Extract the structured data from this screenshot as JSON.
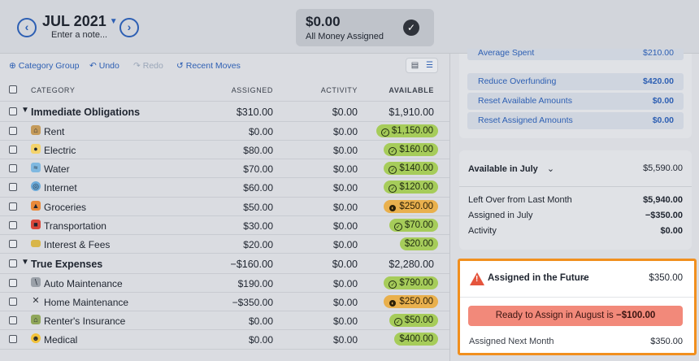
{
  "header": {
    "month": "JUL 2021",
    "note_placeholder": "Enter a note...",
    "assigned_amount": "$0.00",
    "assigned_label": "All Money Assigned"
  },
  "toolbar": {
    "category_group": "Category Group",
    "undo": "Undo",
    "redo": "Redo",
    "recent_moves": "Recent Moves"
  },
  "table": {
    "columns": {
      "category": "CATEGORY",
      "assigned": "ASSIGNED",
      "activity": "ACTIVITY",
      "available": "AVAILABLE"
    },
    "groups": [
      {
        "name": "Immediate Obligations",
        "assigned": "$310.00",
        "activity": "$0.00",
        "available": "$1,910.00",
        "items": [
          {
            "name": "Rent",
            "icon": "house-icon",
            "assigned": "$0.00",
            "activity": "$0.00",
            "available": "$1,150.00",
            "status": "green-check"
          },
          {
            "name": "Electric",
            "icon": "lightbulb-icon",
            "assigned": "$80.00",
            "activity": "$0.00",
            "available": "$160.00",
            "status": "green-check"
          },
          {
            "name": "Water",
            "icon": "water-icon",
            "assigned": "$70.00",
            "activity": "$0.00",
            "available": "$140.00",
            "status": "green-check"
          },
          {
            "name": "Internet",
            "icon": "globe-icon",
            "assigned": "$60.00",
            "activity": "$0.00",
            "available": "$120.00",
            "status": "green-check"
          },
          {
            "name": "Groceries",
            "icon": "carrot-icon",
            "assigned": "$50.00",
            "activity": "$0.00",
            "available": "$250.00",
            "status": "orange-partial"
          },
          {
            "name": "Transportation",
            "icon": "car-icon",
            "assigned": "$30.00",
            "activity": "$0.00",
            "available": "$70.00",
            "status": "green-check"
          },
          {
            "name": "Interest & Fees",
            "icon": "card-icon",
            "assigned": "$20.00",
            "activity": "$0.00",
            "available": "$20.00",
            "status": "green"
          }
        ]
      },
      {
        "name": "True Expenses",
        "assigned": "−$160.00",
        "activity": "$0.00",
        "available": "$2,280.00",
        "items": [
          {
            "name": "Auto Maintenance",
            "icon": "wrench-icon",
            "assigned": "$190.00",
            "activity": "$0.00",
            "available": "$790.00",
            "status": "green-check"
          },
          {
            "name": "Home Maintenance",
            "icon": "tools-icon",
            "assigned": "−$350.00",
            "activity": "$0.00",
            "available": "$250.00",
            "status": "orange-partial"
          },
          {
            "name": "Renter's Insurance",
            "icon": "house-plant-icon",
            "assigned": "$0.00",
            "activity": "$0.00",
            "available": "$50.00",
            "status": "green-check"
          },
          {
            "name": "Medical",
            "icon": "face-icon",
            "assigned": "$0.00",
            "activity": "$0.00",
            "available": "$400.00",
            "status": "green"
          }
        ]
      }
    ]
  },
  "right": {
    "average_spent": {
      "label": "Average Spent",
      "amount": "$210.00"
    },
    "quick_actions": [
      {
        "label": "Reduce Overfunding",
        "amount": "$420.00"
      },
      {
        "label": "Reset Available Amounts",
        "amount": "$0.00"
      },
      {
        "label": "Reset Assigned Amounts",
        "amount": "$0.00"
      }
    ],
    "available": {
      "title": "Available in July",
      "amount": "$5,590.00",
      "rows": [
        {
          "label": "Left Over from Last Month",
          "value": "$5,940.00"
        },
        {
          "label": "Assigned in July",
          "value": "−$350.00"
        },
        {
          "label": "Activity",
          "value": "$0.00"
        }
      ]
    },
    "future": {
      "title": "Assigned in the Future",
      "amount": "$350.00",
      "ready_text": "Ready to Assign in August is ",
      "ready_amount": "−$100.00",
      "next_label": "Assigned Next Month",
      "next_amount": "$350.00"
    }
  },
  "colors": {
    "accent": "#2d5fb3",
    "green_pill": "#a6cc5a",
    "orange_pill": "#e9b04d",
    "warning": "#e5553d",
    "highlight_border": "#f18f1e",
    "ready_bg": "#f2897a"
  }
}
